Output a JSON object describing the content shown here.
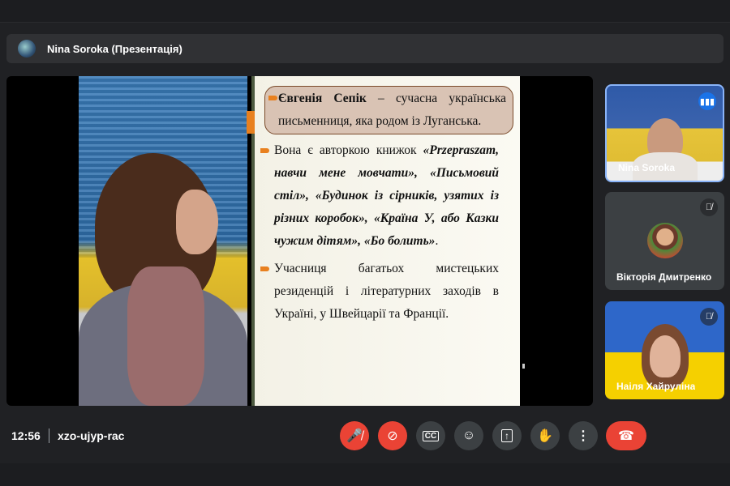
{
  "header": {
    "presenter_title": "Nina Soroka (Презентація)"
  },
  "slide": {
    "p1_bold": "Євгенія Сепік",
    "p1_rest": " – сучасна українська письменниця, яка родом із Луганська.",
    "p2_start": "Вона є авторкою книжок ",
    "p2_italic": "«Przepraszam, навчи мене мовчати», «Письмовий стіл», «Будинок із сірників, узятих із різних коробок», «Країна У, або Казки чужим дітям», «Бо болить»",
    "p2_end": ".",
    "p3": "Учасниця багатьох мистецьких резиденцій і літературних заходів в Україні, у Швейцарії та Франції."
  },
  "participants": [
    {
      "name": "Nina Soroka",
      "status": "speaking"
    },
    {
      "name": "Вікторія Дмитренко",
      "status": "muted"
    },
    {
      "name": "Наіля Хайруліна",
      "status": "muted"
    }
  ],
  "meeting": {
    "time": "12:56",
    "code": "xzo-ujyp-rac"
  },
  "colors": {
    "accent": "#8ab4f8",
    "danger": "#ea4335",
    "control": "#3c4043",
    "bg": "#202124"
  }
}
